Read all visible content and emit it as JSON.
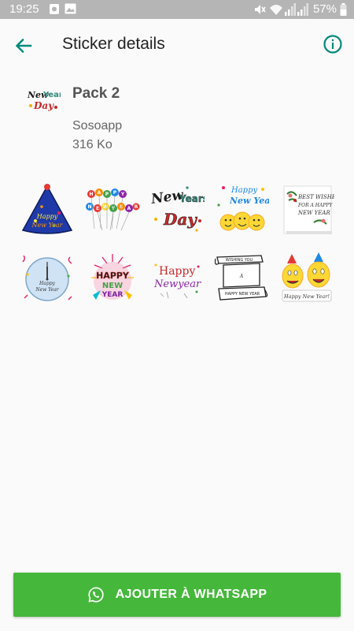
{
  "status_bar": {
    "time": "19:25",
    "battery_percent": "57%",
    "icons": [
      "gallery-icon",
      "notification-icon",
      "mute-icon",
      "wifi-icon",
      "signal-icon",
      "battery-icon"
    ]
  },
  "app_bar": {
    "title": "Sticker details",
    "back_icon": "arrow-left-icon",
    "info_icon": "info-icon"
  },
  "pack": {
    "name": "Pack 2",
    "publisher": "Sosoapp",
    "size": "316 Ko"
  },
  "stickers": [
    {
      "id": "party-hat",
      "text": "Happy New Year"
    },
    {
      "id": "balloons",
      "text": "HAPPY NEW YEAR"
    },
    {
      "id": "new-years-day",
      "text": "New Years Day"
    },
    {
      "id": "emoji-new-year",
      "text": "Happy New Year"
    },
    {
      "id": "best-wishes-card",
      "text": "BEST WISHES FOR A HAPPY NEW YEAR"
    },
    {
      "id": "clock",
      "text": "Happy New Year"
    },
    {
      "id": "fireworks-badge",
      "text": "HAPPY NEW YEAR"
    },
    {
      "id": "happy-newyear-text",
      "text": "Happy Newyear"
    },
    {
      "id": "scroll-banner",
      "text": "Wishing You A Happy New Year"
    },
    {
      "id": "emoji-couple",
      "text": "Happy New Year!"
    }
  ],
  "add_button": {
    "label": "AJOUTER À WHATSAPP",
    "icon": "whatsapp-icon"
  },
  "colors": {
    "accent": "#00897b",
    "button": "#45b83b",
    "status_bar": "#b5b5b5"
  }
}
